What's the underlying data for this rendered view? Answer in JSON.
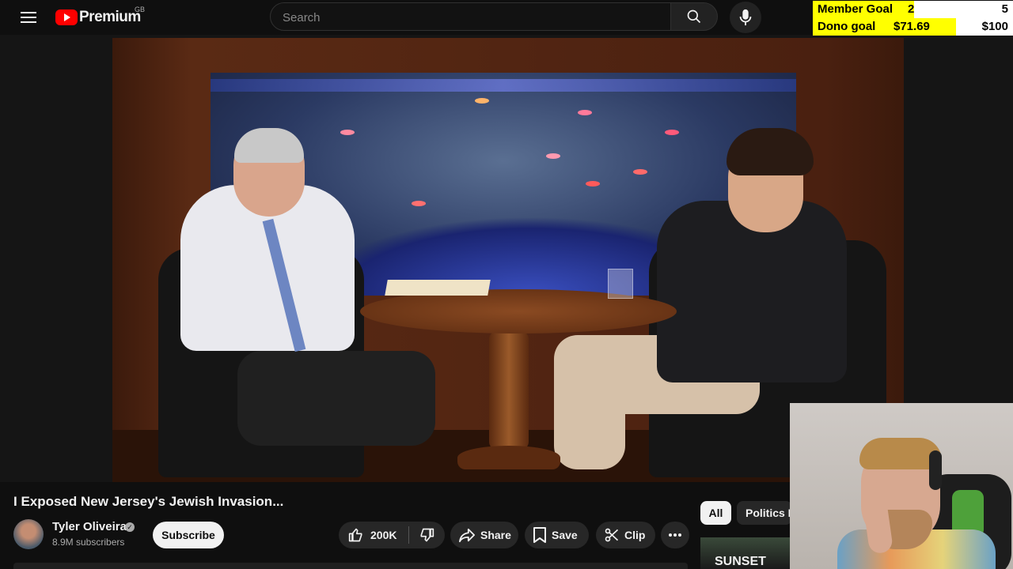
{
  "header": {
    "logo_text": "Premium",
    "logo_country": "GB",
    "search_placeholder": "Search",
    "icons": [
      "menu-icon",
      "search-icon",
      "mic-icon"
    ]
  },
  "overlay": {
    "member_goal_label": "Member Goal",
    "member_goal_current": "2",
    "member_goal_target": "5",
    "dono_goal_label": "Dono goal",
    "dono_goal_current": "$71.69",
    "dono_goal_target": "$100",
    "colors": {
      "goal_fill": "#ffff00",
      "goal_empty": "#ffffff"
    }
  },
  "video": {
    "title": "I Exposed New Jersey's Jewish Invasion...",
    "channel_name": "Tyler Oliveira",
    "subscribers": "8.9M subscribers",
    "subscribe_label": "Subscribe",
    "likes": "200K",
    "share_label": "Share",
    "save_label": "Save",
    "clip_label": "Clip"
  },
  "sidebar": {
    "chips": [
      "All",
      "Politics N"
    ],
    "thumb_text": "SUNSET"
  }
}
